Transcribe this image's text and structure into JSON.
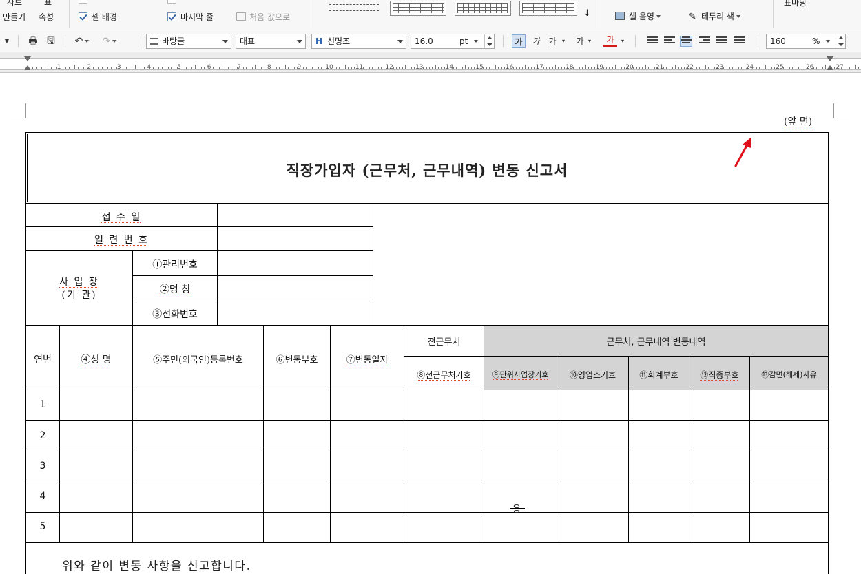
{
  "ribbon": {
    "chart_make_top": "차트",
    "chart_make_bottom": "만들기",
    "table_prop_top": "표",
    "table_prop_bottom": "속성",
    "cell_bg": "셀 배경",
    "last_row": "마지막 줄",
    "first_value": "처음 값으로",
    "cell_sound": "셀 음영",
    "border_color": "테두리 색",
    "table_style": "표마당"
  },
  "toolbar": {
    "style_value": "바탕글",
    "para_value": "대표",
    "font_value": "신명조",
    "font_size": "16.0",
    "font_unit": "pt",
    "bold_glyph": "가",
    "italic_glyph": "가",
    "underline_glyph": "가",
    "strike_glyph": "가",
    "color_glyph": "가",
    "zoom_value": "160",
    "zoom_unit": "%"
  },
  "ruler": {
    "numbers": [
      "1",
      "2",
      "3",
      "4",
      "5",
      "6",
      "7",
      "8",
      "9",
      "10",
      "11",
      "12",
      "13",
      "14",
      "15",
      "16",
      "17",
      "18",
      "19",
      "20",
      "21",
      "22",
      "23",
      "24",
      "25",
      "26",
      "27"
    ]
  },
  "document": {
    "front_label": "(앞 면)",
    "title": "직장가입자 (근무처, 근무내역) 변동 신고서",
    "receipt_date": "접 수 일",
    "serial_no": "일 련 번 호",
    "workplace": "사 업 장",
    "agency": "(기 관)",
    "mgmt_no": "①관리번호",
    "name_label": "②명 칭",
    "phone": "③전화번호",
    "col_seq": "연번",
    "col_name": "④성 명",
    "col_rrn": "⑤주민(외국인)등록번호",
    "col_change_code": "⑥변동부호",
    "col_change_date": "⑦변동일자",
    "col_prev_work": "전근무처",
    "col_prev_work_code": "⑧전근무처기호",
    "col_group_header": "근무처, 근무내역 변동내역",
    "col_unit_code": "⑨단위사업장기호",
    "col_branch_code": "⑩영업소기호",
    "col_account_code": "⑪회계부호",
    "col_job_code": "⑫직종부호",
    "col_exempt_reason": "⑬감면(해제)사유",
    "rows": [
      "1",
      "2",
      "3",
      "4",
      "5"
    ],
    "mid_mark": "용",
    "declaration": "위와 같이 변동 사항을 신고합니다."
  },
  "colors": {
    "header_gray": "#d4d4d4",
    "arrow_red": "#e0101a",
    "spell_underline": "#e34b2c"
  }
}
